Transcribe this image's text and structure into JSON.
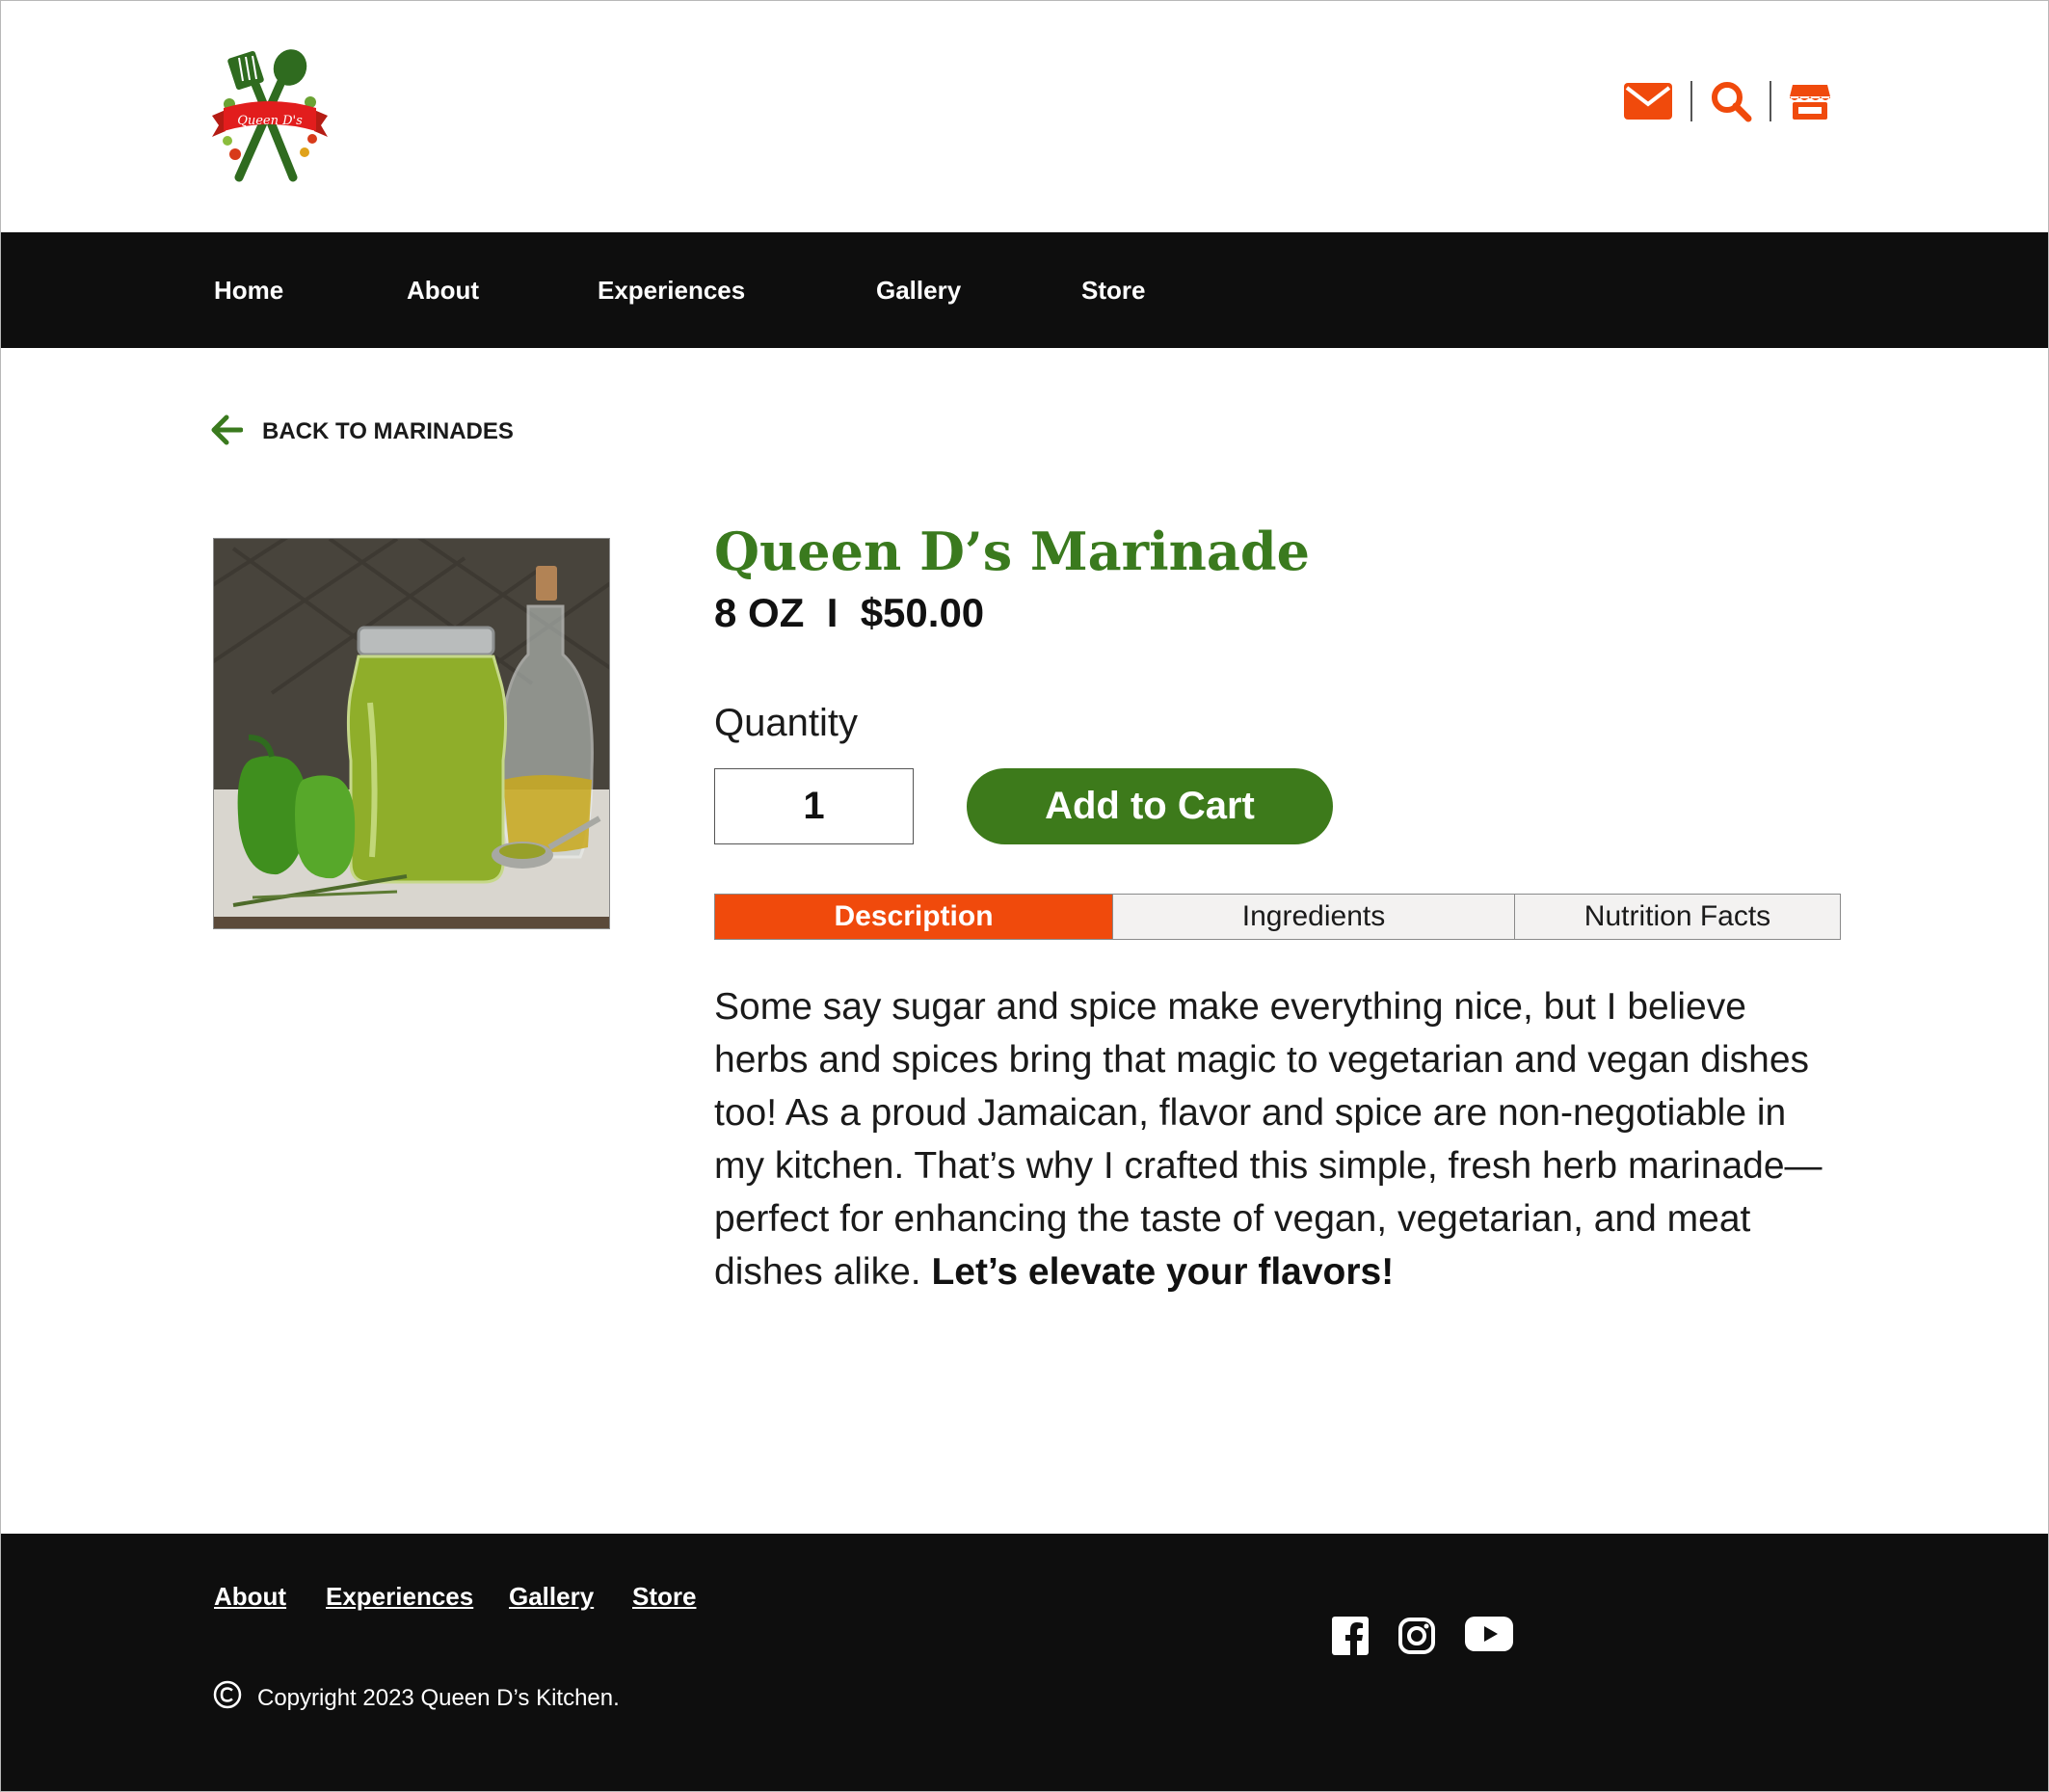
{
  "header": {
    "logo_text": "Queen D's",
    "icons": [
      "mail-icon",
      "search-icon",
      "store-icon"
    ]
  },
  "nav": {
    "items": [
      {
        "label": "Home"
      },
      {
        "label": "About"
      },
      {
        "label": "Experiences"
      },
      {
        "label": "Gallery"
      },
      {
        "label": "Store"
      }
    ]
  },
  "back_link": {
    "label": "BACK TO MARINADES",
    "icon": "arrow-left-icon"
  },
  "product": {
    "title": "Queen D’s Marinade",
    "subtitle": "8 OZ  I  $50.00",
    "quantity_label": "Quantity",
    "quantity_value": "1",
    "add_to_cart_label": "Add to Cart"
  },
  "tabs": [
    {
      "label": "Description",
      "active": true
    },
    {
      "label": "Ingredients",
      "active": false
    },
    {
      "label": "Nutrition Facts",
      "active": false
    }
  ],
  "description": {
    "text": "Some say sugar and spice make everything nice, but I believe herbs and spices bring that magic to vegetarian and vegan dishes too! As a proud Jamaican, flavor and spice are non-negotiable in my kitchen. That’s why I crafted this simple, fresh herb marinade—perfect for enhancing the taste of vegan, vegetarian, and meat dishes alike.",
    "emphasis": "Let’s elevate your flavors!"
  },
  "footer": {
    "links": [
      {
        "label": "About"
      },
      {
        "label": "Experiences"
      },
      {
        "label": "Gallery"
      },
      {
        "label": "Store"
      }
    ],
    "social": [
      "facebook-icon",
      "instagram-icon",
      "youtube-icon"
    ],
    "copyright": "Copyright 2023 Queen D’s Kitchen."
  },
  "colors": {
    "accent_orange": "#f04a0c",
    "brand_green": "#3d7a1b",
    "nav_bg": "#0e0e0e"
  }
}
